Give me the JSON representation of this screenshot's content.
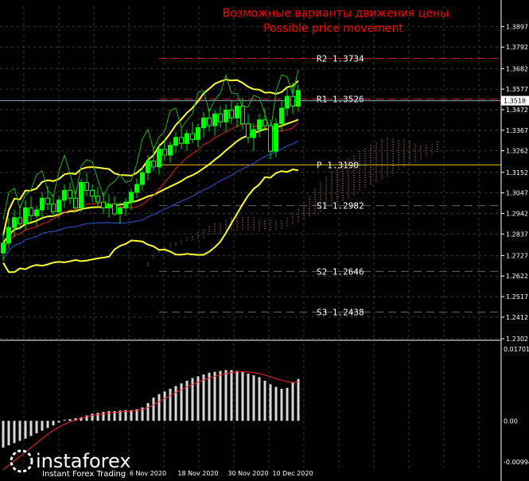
{
  "title_ru": "Возможные варианты движения цены",
  "title_en": "Possible price movement",
  "brand": {
    "name": "instaforex",
    "tagline": "Instant Forex Trading"
  },
  "chart_data": {
    "type": "candlestick",
    "price_axis": {
      "min": 1.2302,
      "max": 1.4,
      "ticks": [
        "1.3897",
        "1.3792",
        "1.3682",
        "1.3577",
        "1.3472",
        "1.3367",
        "1.3262",
        "1.3152",
        "1.3047",
        "1.2942",
        "1.2837",
        "1.2727",
        "1.2622",
        "1.2517",
        "1.2412",
        "1.2302"
      ],
      "current_price": "1.3518"
    },
    "levels": [
      {
        "name": "R2",
        "value": "1.3734",
        "color": "#cc2222"
      },
      {
        "name": "R1",
        "value": "1.3526",
        "color": "#cc2222"
      },
      {
        "name": "P",
        "value": "1.3190",
        "color": "#e6c200"
      },
      {
        "name": "S1",
        "value": "1.2982",
        "color": "#666666"
      },
      {
        "name": "S2",
        "value": "1.2646",
        "color": "#666666"
      },
      {
        "name": "S3",
        "value": "1.2438",
        "color": "#666666"
      }
    ],
    "date_labels": [
      "6 Nov 2020",
      "18 Nov 2020",
      "30 Nov 2020",
      "10 Dec 2020"
    ],
    "date_label_index": [
      26,
      35,
      44,
      52
    ],
    "candles": [
      [
        1.274,
        1.284,
        1.27,
        1.279
      ],
      [
        1.279,
        1.292,
        1.276,
        1.287
      ],
      [
        1.287,
        1.296,
        1.282,
        1.292
      ],
      [
        1.292,
        1.298,
        1.286,
        1.289
      ],
      [
        1.289,
        1.301,
        1.286,
        1.297
      ],
      [
        1.297,
        1.303,
        1.29,
        1.293
      ],
      [
        1.293,
        1.298,
        1.288,
        1.296
      ],
      [
        1.296,
        1.305,
        1.292,
        1.302
      ],
      [
        1.302,
        1.308,
        1.296,
        1.299
      ],
      [
        1.299,
        1.304,
        1.293,
        1.295
      ],
      [
        1.295,
        1.303,
        1.292,
        1.301
      ],
      [
        1.301,
        1.309,
        1.297,
        1.306
      ],
      [
        1.306,
        1.31,
        1.299,
        1.302
      ],
      [
        1.302,
        1.306,
        1.295,
        1.297
      ],
      [
        1.297,
        1.312,
        1.295,
        1.31
      ],
      [
        1.31,
        1.315,
        1.303,
        1.306
      ],
      [
        1.306,
        1.309,
        1.3,
        1.303
      ],
      [
        1.303,
        1.308,
        1.298,
        1.3
      ],
      [
        1.3,
        1.305,
        1.294,
        1.297
      ],
      [
        1.297,
        1.304,
        1.292,
        1.299
      ],
      [
        1.299,
        1.303,
        1.293,
        1.294
      ],
      [
        1.294,
        1.3,
        1.289,
        1.297
      ],
      [
        1.297,
        1.302,
        1.293,
        1.3
      ],
      [
        1.3,
        1.307,
        1.296,
        1.305
      ],
      [
        1.305,
        1.312,
        1.302,
        1.309
      ],
      [
        1.309,
        1.318,
        1.306,
        1.315
      ],
      [
        1.315,
        1.324,
        1.311,
        1.321
      ],
      [
        1.321,
        1.328,
        1.316,
        1.318
      ],
      [
        1.318,
        1.33,
        1.314,
        1.327
      ],
      [
        1.327,
        1.332,
        1.321,
        1.324
      ],
      [
        1.324,
        1.331,
        1.32,
        1.329
      ],
      [
        1.329,
        1.336,
        1.325,
        1.333
      ],
      [
        1.333,
        1.338,
        1.327,
        1.33
      ],
      [
        1.33,
        1.337,
        1.326,
        1.335
      ],
      [
        1.335,
        1.341,
        1.33,
        1.332
      ],
      [
        1.332,
        1.34,
        1.328,
        1.338
      ],
      [
        1.338,
        1.346,
        1.333,
        1.343
      ],
      [
        1.343,
        1.348,
        1.336,
        1.339
      ],
      [
        1.339,
        1.347,
        1.334,
        1.345
      ],
      [
        1.345,
        1.349,
        1.338,
        1.341
      ],
      [
        1.341,
        1.35,
        1.336,
        1.347
      ],
      [
        1.347,
        1.352,
        1.34,
        1.343
      ],
      [
        1.343,
        1.351,
        1.338,
        1.349
      ],
      [
        1.349,
        1.353,
        1.337,
        1.34
      ],
      [
        1.34,
        1.345,
        1.33,
        1.333
      ],
      [
        1.333,
        1.34,
        1.326,
        1.337
      ],
      [
        1.337,
        1.345,
        1.333,
        1.342
      ],
      [
        1.342,
        1.348,
        1.336,
        1.339
      ],
      [
        1.339,
        1.342,
        1.322,
        1.326
      ],
      [
        1.326,
        1.343,
        1.323,
        1.34
      ],
      [
        1.34,
        1.352,
        1.336,
        1.348
      ],
      [
        1.348,
        1.358,
        1.344,
        1.354
      ],
      [
        1.354,
        1.361,
        1.345,
        1.349
      ],
      [
        1.349,
        1.36,
        1.346,
        1.357
      ]
    ],
    "oscillator": {
      "max_label": "0.01701",
      "zero_label": "0.00",
      "min_label": "-0.00994",
      "min": -0.00994,
      "max": 0.01701
    },
    "histogram": [
      -0.006,
      -0.0055,
      -0.005,
      -0.0045,
      -0.004,
      -0.0034,
      -0.0028,
      -0.0022,
      -0.0016,
      -0.001,
      -0.0004,
      0.0002,
      0.0004,
      0.0006,
      0.0008,
      0.0012,
      0.0016,
      0.0018,
      0.002,
      0.0022,
      0.0022,
      0.0023,
      0.0024,
      0.0024,
      0.0026,
      0.003,
      0.004,
      0.0052,
      0.006,
      0.0066,
      0.0072,
      0.0078,
      0.0084,
      0.009,
      0.0096,
      0.01,
      0.0104,
      0.0108,
      0.011,
      0.0112,
      0.0114,
      0.0114,
      0.0112,
      0.011,
      0.0106,
      0.0102,
      0.0098,
      0.009,
      0.0082,
      0.0076,
      0.0072,
      0.0074,
      0.0086,
      0.0094
    ],
    "signal": [
      -0.011,
      -0.01,
      -0.009,
      -0.008,
      -0.007,
      -0.006,
      -0.005,
      -0.004,
      -0.003,
      -0.0022,
      -0.0014,
      -0.0008,
      -0.0002,
      0.0002,
      0.0006,
      0.0009,
      0.0012,
      0.0014,
      0.0016,
      0.0018,
      0.0019,
      0.002,
      0.0021,
      0.0022,
      0.0023,
      0.0025,
      0.003,
      0.0036,
      0.0043,
      0.005,
      0.0057,
      0.0064,
      0.007,
      0.0076,
      0.0082,
      0.0087,
      0.0092,
      0.0096,
      0.01,
      0.0103,
      0.0106,
      0.0108,
      0.011,
      0.011,
      0.011,
      0.0108,
      0.0106,
      0.0103,
      0.0099,
      0.0095,
      0.0091,
      0.0088,
      0.0086,
      0.0088
    ]
  }
}
